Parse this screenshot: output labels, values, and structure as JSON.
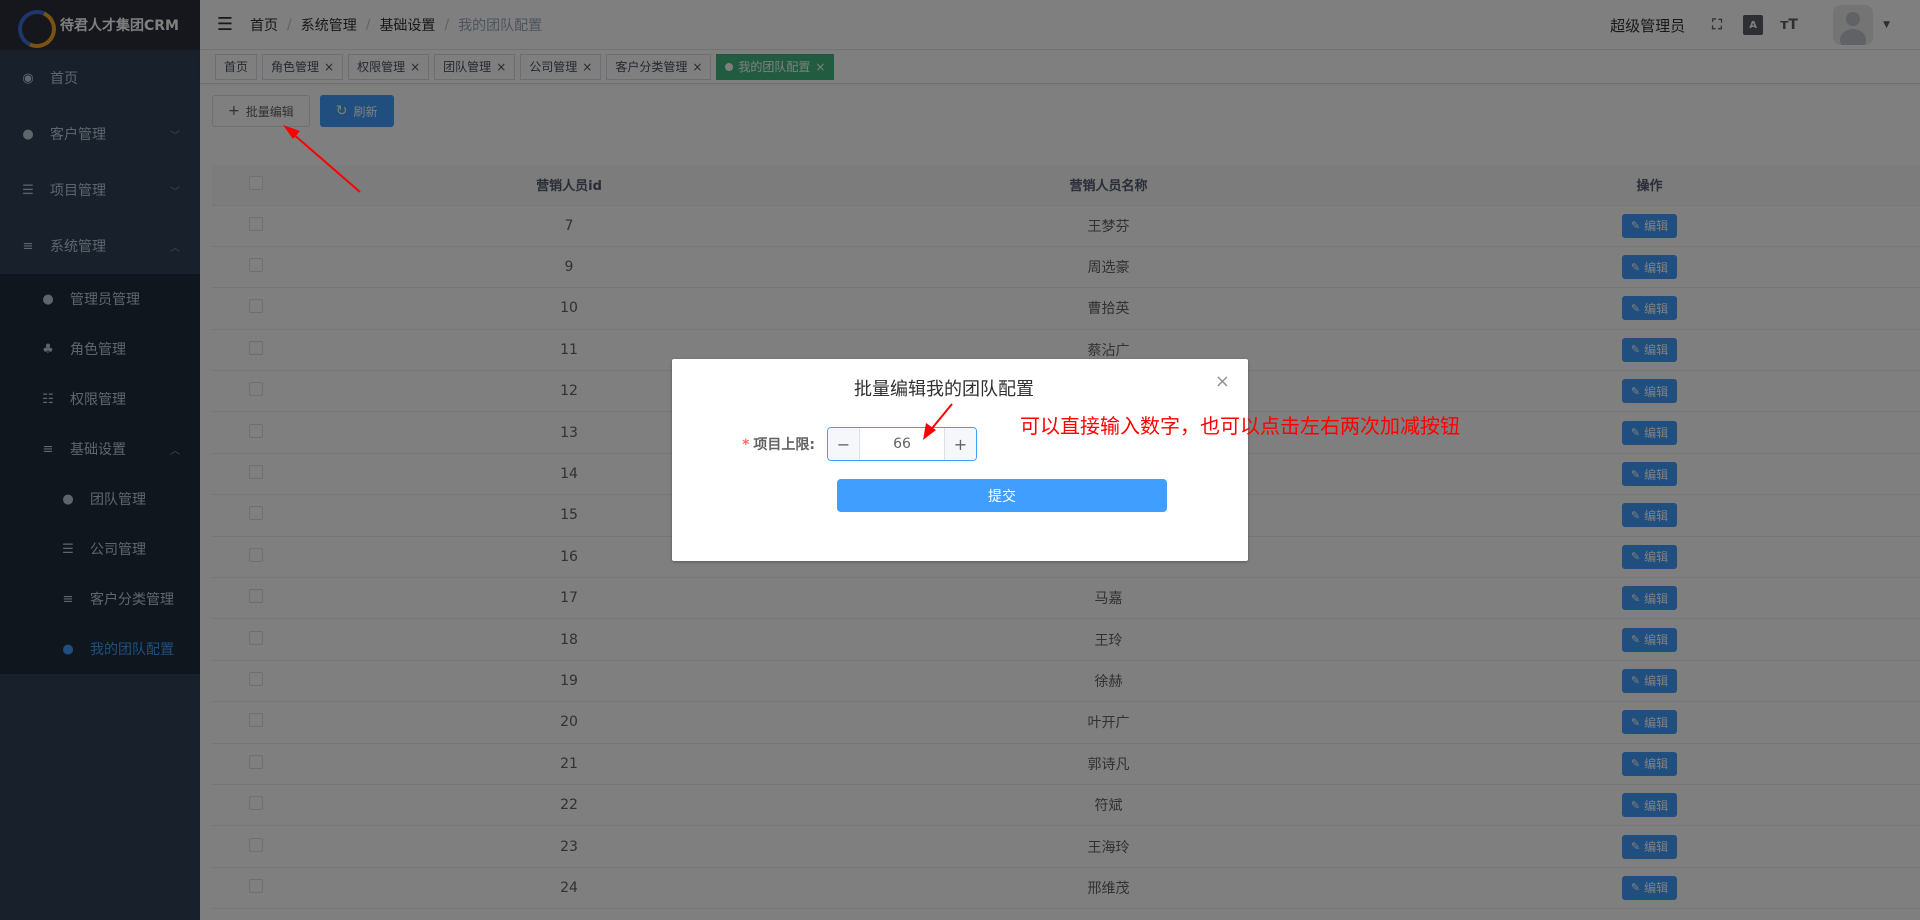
{
  "sidebar": {
    "logo_text": "待君人才集团CRM",
    "items": [
      {
        "label": "首页",
        "icon": "dashboard-icon"
      },
      {
        "label": "客户管理",
        "icon": "peoples-icon"
      },
      {
        "label": "项目管理",
        "icon": "list-icon"
      },
      {
        "label": "系统管理",
        "icon": "settings-icon"
      }
    ],
    "system_sub": [
      {
        "label": "管理员管理",
        "icon": "user-icon"
      },
      {
        "label": "角色管理",
        "icon": "tree-icon"
      },
      {
        "label": "权限管理",
        "icon": "tree-table-icon"
      },
      {
        "label": "基础设置",
        "icon": "settings-icon"
      }
    ],
    "basic_sub": [
      {
        "label": "团队管理",
        "icon": "peoples-icon"
      },
      {
        "label": "公司管理",
        "icon": "list-icon"
      },
      {
        "label": "客户分类管理",
        "icon": "settings-icon"
      },
      {
        "label": "我的团队配置",
        "icon": "peoples-icon"
      }
    ]
  },
  "navbar": {
    "breadcrumb": [
      "首页",
      "系统管理",
      "基础设置",
      "我的团队配置"
    ],
    "username": "超级管理员"
  },
  "tags": [
    "首页",
    "角色管理",
    "权限管理",
    "团队管理",
    "公司管理",
    "客户分类管理",
    "我的团队配置"
  ],
  "toolbar": {
    "batch_edit_label": "批量编辑",
    "refresh_label": "刷新"
  },
  "table": {
    "headers": [
      "营销人员id",
      "营销人员名称",
      "操作"
    ],
    "edit_label": "编辑",
    "rows": [
      {
        "id": "7",
        "name": "王梦芬"
      },
      {
        "id": "9",
        "name": "周选豪"
      },
      {
        "id": "10",
        "name": "曹拾英"
      },
      {
        "id": "11",
        "name": "蔡沾广"
      },
      {
        "id": "12",
        "name": ""
      },
      {
        "id": "13",
        "name": ""
      },
      {
        "id": "14",
        "name": ""
      },
      {
        "id": "15",
        "name": ""
      },
      {
        "id": "16",
        "name": ""
      },
      {
        "id": "17",
        "name": "马嘉"
      },
      {
        "id": "18",
        "name": "王玲"
      },
      {
        "id": "19",
        "name": "徐赫"
      },
      {
        "id": "20",
        "name": "叶开广"
      },
      {
        "id": "21",
        "name": "郭诗凡"
      },
      {
        "id": "22",
        "name": "符斌"
      },
      {
        "id": "23",
        "name": "王海玲"
      },
      {
        "id": "24",
        "name": "邢维茂"
      }
    ]
  },
  "dialog": {
    "title": "批量编辑我的团队配置",
    "field_label": "项目上限:",
    "required_mark": "*",
    "value": "66",
    "minus": "−",
    "plus": "+",
    "submit_label": "提交",
    "close": "×"
  },
  "annotation": {
    "text": "可以直接输入数字，也可以点击左右两次加减按钮",
    "color": "#ff0000"
  }
}
